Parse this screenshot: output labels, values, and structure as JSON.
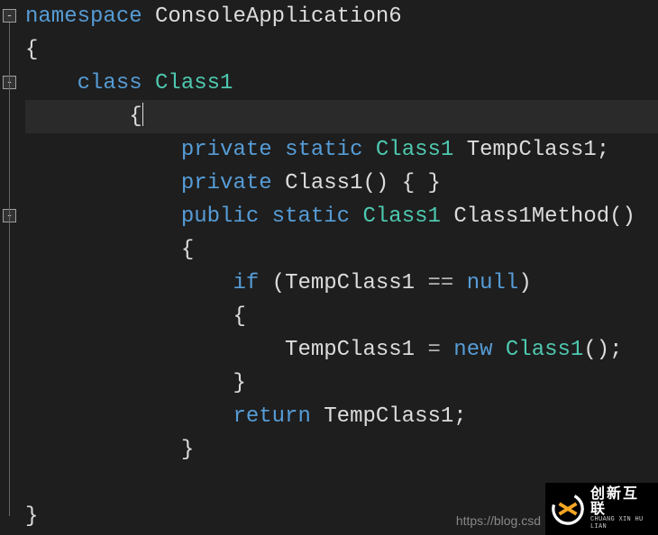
{
  "code": {
    "lines": [
      {
        "indent": 0,
        "tokens": [
          {
            "t": "kw",
            "v": "namespace"
          },
          {
            "t": "sp",
            "v": " "
          },
          {
            "t": "ident",
            "v": "ConsoleApplication6"
          }
        ]
      },
      {
        "indent": 0,
        "tokens": [
          {
            "t": "punc",
            "v": "{"
          }
        ]
      },
      {
        "indent": 1,
        "tokens": [
          {
            "t": "kw",
            "v": "class"
          },
          {
            "t": "sp",
            "v": " "
          },
          {
            "t": "type",
            "v": "Class1"
          }
        ]
      },
      {
        "indent": 2,
        "tokens": [
          {
            "t": "punc",
            "v": "{"
          }
        ],
        "highlight": true,
        "cursor": true
      },
      {
        "indent": 3,
        "tokens": [
          {
            "t": "kw",
            "v": "private"
          },
          {
            "t": "sp",
            "v": " "
          },
          {
            "t": "kw",
            "v": "static"
          },
          {
            "t": "sp",
            "v": " "
          },
          {
            "t": "type",
            "v": "Class1"
          },
          {
            "t": "sp",
            "v": " "
          },
          {
            "t": "ident",
            "v": "TempClass1"
          },
          {
            "t": "punc",
            "v": ";"
          }
        ]
      },
      {
        "indent": 3,
        "tokens": [
          {
            "t": "kw",
            "v": "private"
          },
          {
            "t": "sp",
            "v": " "
          },
          {
            "t": "ident",
            "v": "Class1"
          },
          {
            "t": "punc",
            "v": "() { }"
          }
        ]
      },
      {
        "indent": 3,
        "tokens": [
          {
            "t": "kw",
            "v": "public"
          },
          {
            "t": "sp",
            "v": " "
          },
          {
            "t": "kw",
            "v": "static"
          },
          {
            "t": "sp",
            "v": " "
          },
          {
            "t": "type",
            "v": "Class1"
          },
          {
            "t": "sp",
            "v": " "
          },
          {
            "t": "ident",
            "v": "Class1Method"
          },
          {
            "t": "punc",
            "v": "()"
          }
        ]
      },
      {
        "indent": 3,
        "tokens": [
          {
            "t": "punc",
            "v": "{"
          }
        ]
      },
      {
        "indent": 4,
        "tokens": [
          {
            "t": "kw",
            "v": "if"
          },
          {
            "t": "sp",
            "v": " "
          },
          {
            "t": "punc",
            "v": "("
          },
          {
            "t": "ident",
            "v": "TempClass1"
          },
          {
            "t": "sp",
            "v": " "
          },
          {
            "t": "op",
            "v": "=="
          },
          {
            "t": "sp",
            "v": " "
          },
          {
            "t": "kw",
            "v": "null"
          },
          {
            "t": "punc",
            "v": ")"
          }
        ]
      },
      {
        "indent": 4,
        "tokens": [
          {
            "t": "punc",
            "v": "{"
          }
        ]
      },
      {
        "indent": 5,
        "tokens": [
          {
            "t": "ident",
            "v": "TempClass1"
          },
          {
            "t": "sp",
            "v": " "
          },
          {
            "t": "op",
            "v": "="
          },
          {
            "t": "sp",
            "v": " "
          },
          {
            "t": "kw",
            "v": "new"
          },
          {
            "t": "sp",
            "v": " "
          },
          {
            "t": "type",
            "v": "Class1"
          },
          {
            "t": "punc",
            "v": "();"
          }
        ]
      },
      {
        "indent": 4,
        "tokens": [
          {
            "t": "punc",
            "v": "}"
          }
        ]
      },
      {
        "indent": 4,
        "tokens": [
          {
            "t": "kw",
            "v": "return"
          },
          {
            "t": "sp",
            "v": " "
          },
          {
            "t": "ident",
            "v": "TempClass1"
          },
          {
            "t": "punc",
            "v": ";"
          }
        ]
      },
      {
        "indent": 3,
        "tokens": [
          {
            "t": "punc",
            "v": "}"
          }
        ]
      },
      {
        "indent": 0,
        "tokens": []
      },
      {
        "indent": 0,
        "tokens": [
          {
            "t": "punc",
            "v": "}"
          }
        ]
      }
    ],
    "folds": [
      {
        "line": 0,
        "symbol": "-"
      },
      {
        "line": 2,
        "symbol": "-"
      },
      {
        "line": 6,
        "symbol": "-"
      }
    ]
  },
  "watermark": "https://blog.csd",
  "logo": {
    "cn": "创新互联",
    "en": "CHUANG XIN HU LIAN"
  }
}
